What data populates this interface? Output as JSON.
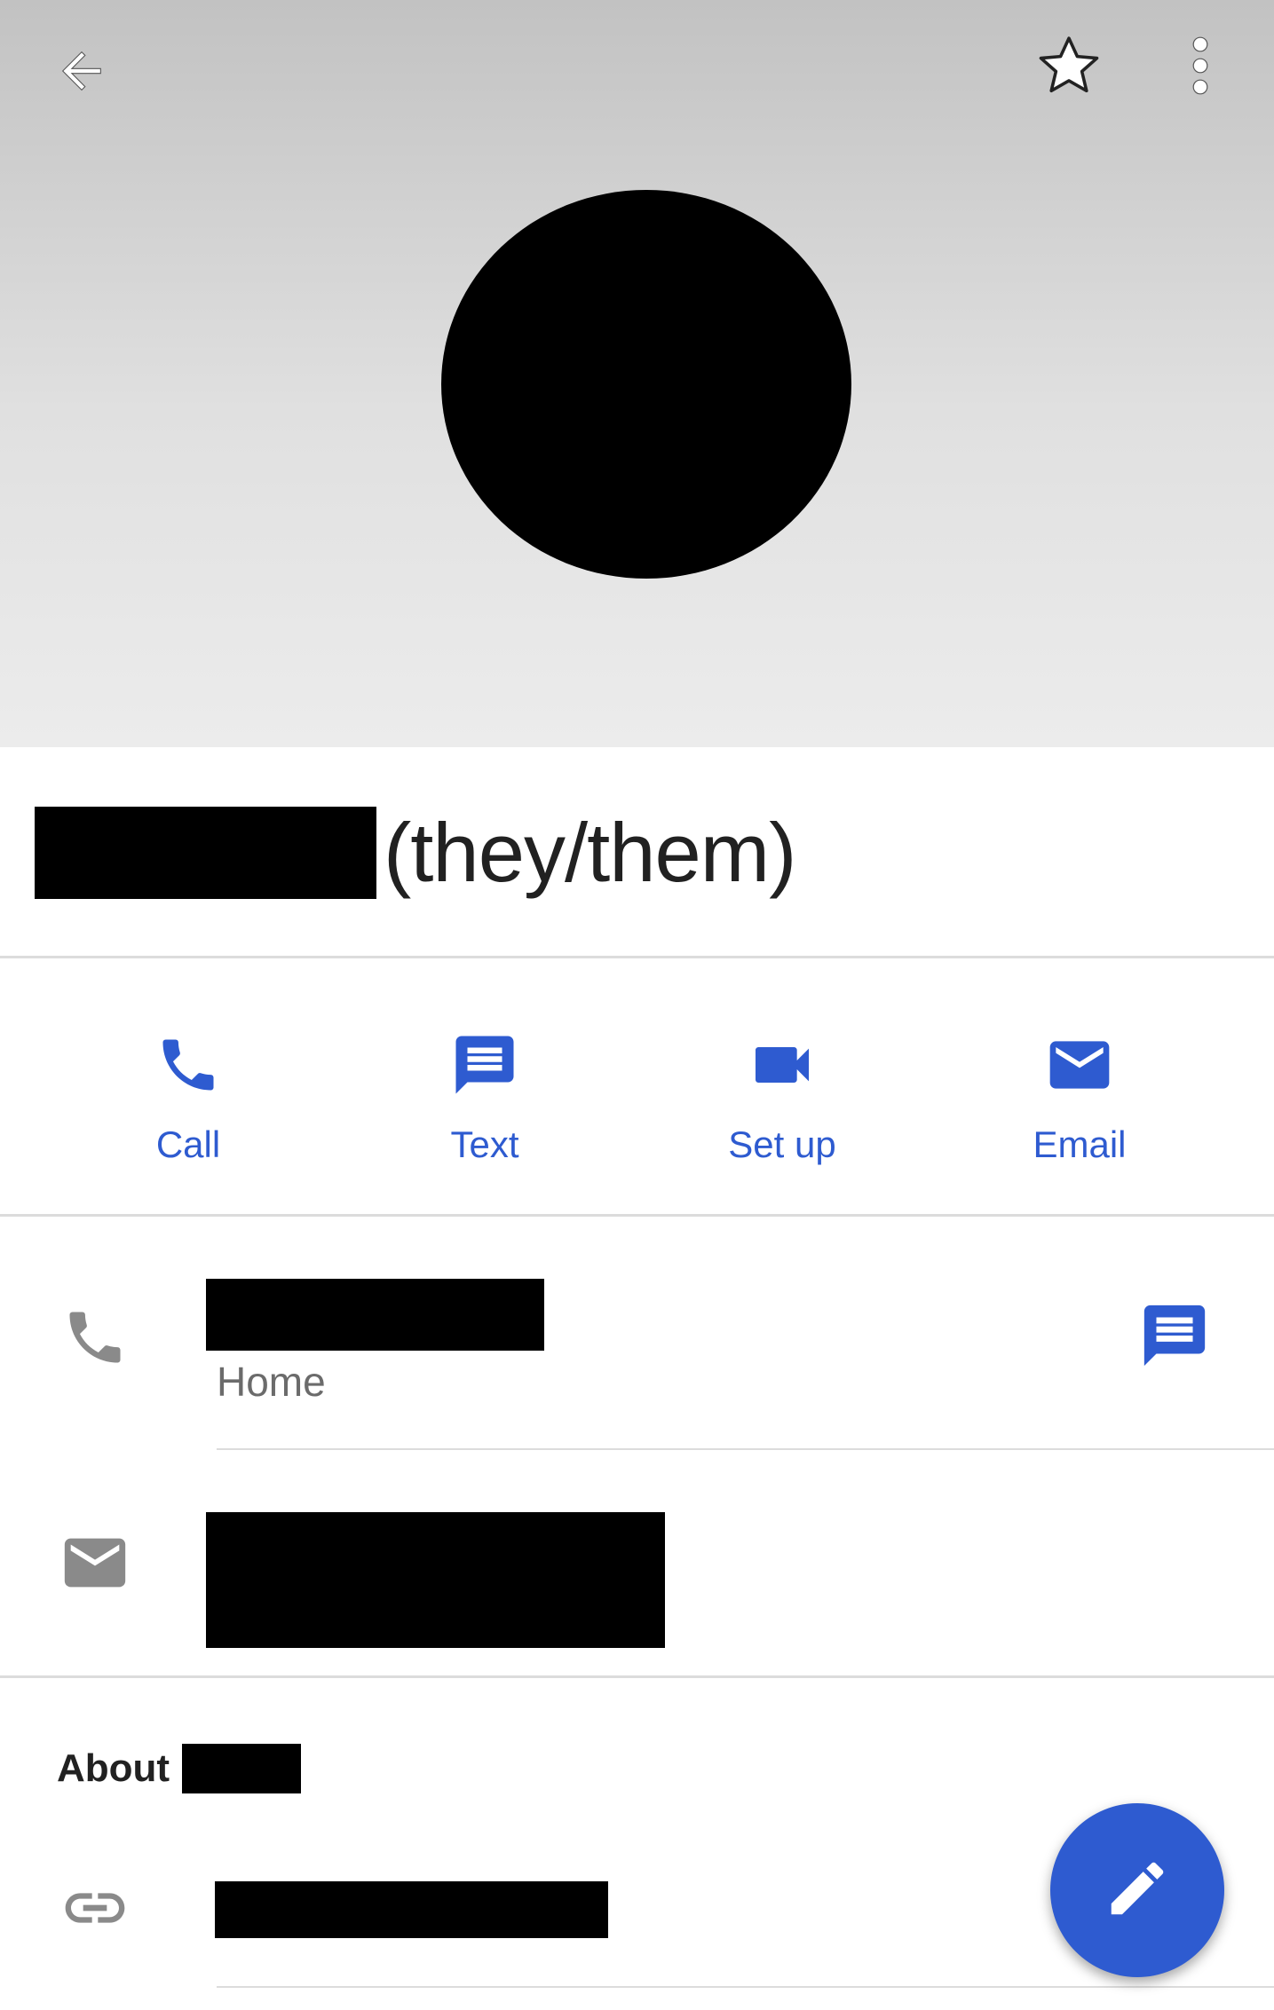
{
  "header": {
    "back_icon": "arrow-back-icon",
    "star_icon": "star-outline-icon",
    "more_icon": "more-vert-icon"
  },
  "contact": {
    "pronouns": "(they/them)"
  },
  "actions": [
    {
      "label": "Call",
      "icon": "phone-icon"
    },
    {
      "label": "Text",
      "icon": "message-icon"
    },
    {
      "label": "Set up",
      "icon": "video-icon"
    },
    {
      "label": "Email",
      "icon": "email-icon"
    }
  ],
  "details": {
    "phone": {
      "type_label": "Home",
      "icon": "phone-icon",
      "action_icon": "message-icon"
    },
    "email": {
      "icon": "email-icon"
    }
  },
  "about": {
    "title": "About",
    "link_icon": "link-icon"
  },
  "fab": {
    "icon": "edit-pencil-icon"
  },
  "colors": {
    "accent": "#2e5bd0",
    "icon_grey": "#8a8a8a",
    "divider": "#dcdcdc"
  }
}
